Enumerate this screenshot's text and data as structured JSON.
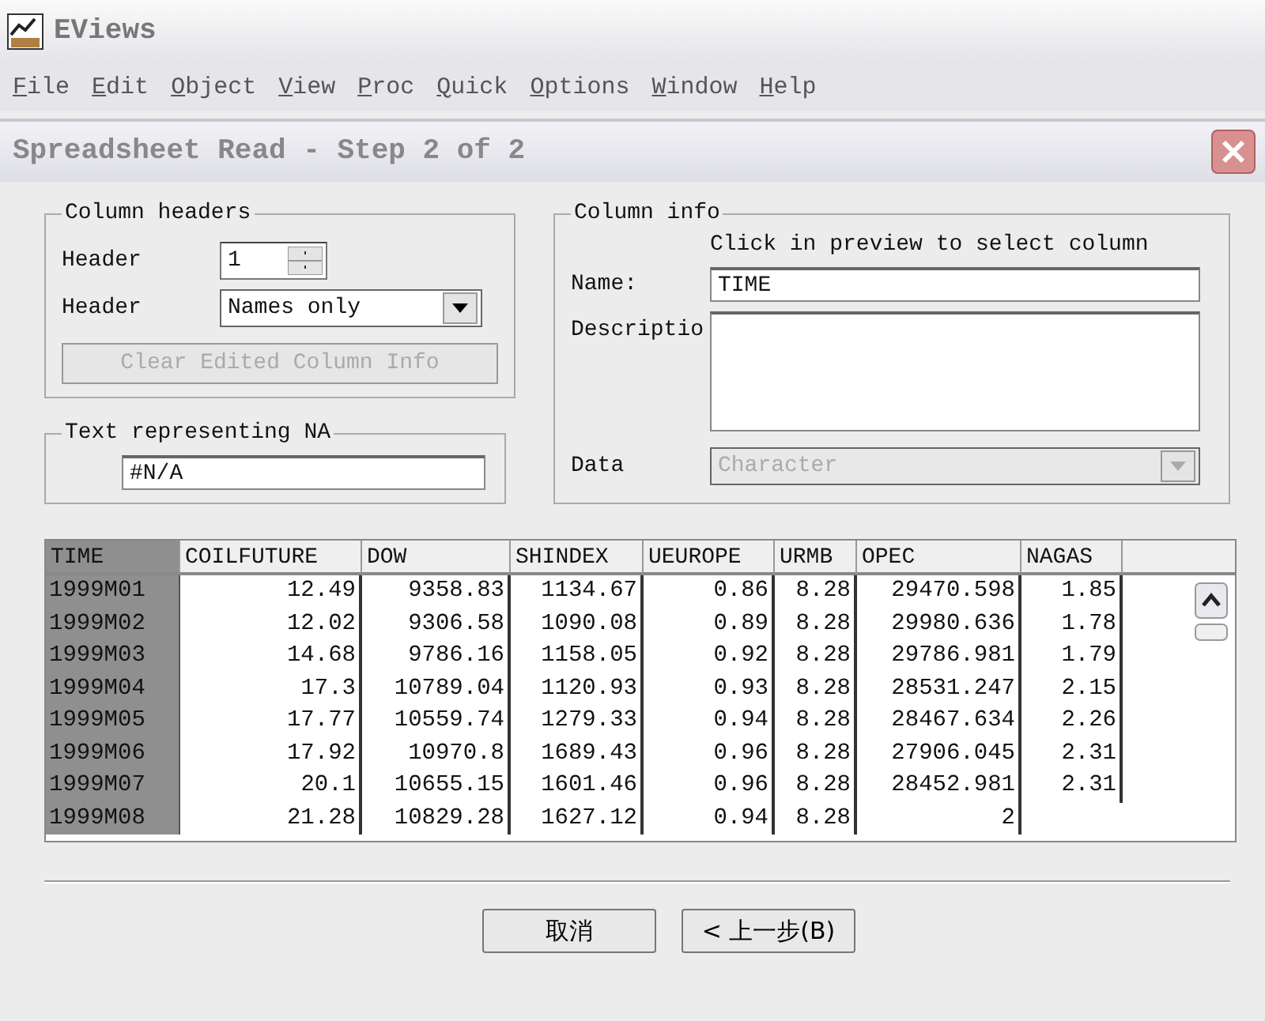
{
  "app": {
    "title": "EViews"
  },
  "menu": [
    "File",
    "Edit",
    "Object",
    "View",
    "Proc",
    "Quick",
    "Options",
    "Window",
    "Help"
  ],
  "dialog": {
    "title": "Spreadsheet Read - Step 2 of 2",
    "column_headers": {
      "legend": "Column headers",
      "header_label": "Header",
      "header_value": "1",
      "header_type_label": "Header",
      "header_type_value": "Names only",
      "clear_button": {
        "label": "Clear Edited Column Info",
        "disabled": true
      }
    },
    "na": {
      "legend": "Text representing NA",
      "value": "#N/A"
    },
    "column_info": {
      "legend": "Column info",
      "hint": "Click in preview to select column",
      "name_label": "Name:",
      "name_value": "TIME",
      "description_label": "Descriptio",
      "data_label": "Data",
      "data_value": "Character",
      "data_disabled": true
    },
    "preview": {
      "columns": [
        {
          "label": "TIME",
          "selected": true
        },
        {
          "label": "COILFUTURE",
          "selected": false
        },
        {
          "label": "DOW",
          "selected": false
        },
        {
          "label": "SHINDEX",
          "selected": false
        },
        {
          "label": "UEUROPE",
          "selected": false
        },
        {
          "label": "URMB",
          "selected": false
        },
        {
          "label": "OPEC",
          "selected": false
        },
        {
          "label": "NAGAS",
          "selected": false
        }
      ],
      "rows": [
        [
          "1999M01",
          "12.49",
          "9358.83",
          "1134.67",
          "0.86",
          "8.28",
          "29470.598",
          "1.85"
        ],
        [
          "1999M02",
          "12.02",
          "9306.58",
          "1090.08",
          "0.89",
          "8.28",
          "29980.636",
          "1.78"
        ],
        [
          "1999M03",
          "14.68",
          "9786.16",
          "1158.05",
          "0.92",
          "8.28",
          "29786.981",
          "1.79"
        ],
        [
          "1999M04",
          "17.3",
          "10789.04",
          "1120.93",
          "0.93",
          "8.28",
          "28531.247",
          "2.15"
        ],
        [
          "1999M05",
          "17.77",
          "10559.74",
          "1279.33",
          "0.94",
          "8.28",
          "28467.634",
          "2.26"
        ],
        [
          "1999M06",
          "17.92",
          "10970.8",
          "1689.43",
          "0.96",
          "8.28",
          "27906.045",
          "2.31"
        ],
        [
          "1999M07",
          "20.1",
          "10655.15",
          "1601.46",
          "0.96",
          "8.28",
          "28452.981",
          "2.31"
        ],
        [
          "1999M08",
          "21.28",
          "10829.28",
          "1627.12",
          "0.94",
          "8.28",
          "2"
        ]
      ]
    },
    "buttons": [
      "取消",
      "< 上一步(B)"
    ]
  }
}
